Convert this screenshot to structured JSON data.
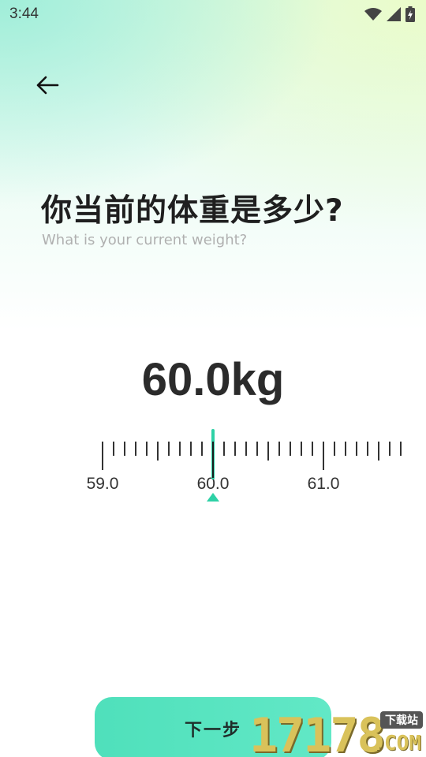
{
  "status_bar": {
    "time": "3:44",
    "icons": [
      "wifi-icon",
      "cell-signal-icon",
      "battery-charging-icon"
    ]
  },
  "nav": {
    "back_icon": "arrow-left-icon"
  },
  "question": {
    "title": "你当前的体重是多少?",
    "subtitle": "What is your current weight?"
  },
  "weight": {
    "display": "60.0kg",
    "value": 60.0,
    "unit": "kg"
  },
  "ruler": {
    "min_visible": 58.99,
    "max_visible": 61.74,
    "step": 0.1,
    "selected": 60.0,
    "labels": [
      "59.0",
      "60.0",
      "61.0"
    ],
    "accent_color": "#2ed1a6"
  },
  "footer": {
    "next_label": "下一步"
  },
  "watermark": {
    "digits": "17178",
    "badge": "下载站",
    "suffix": ".COM"
  },
  "colors": {
    "accent": "#2ed1a6",
    "button_start": "#4fe0bb",
    "button_end": "#62e8c6"
  }
}
